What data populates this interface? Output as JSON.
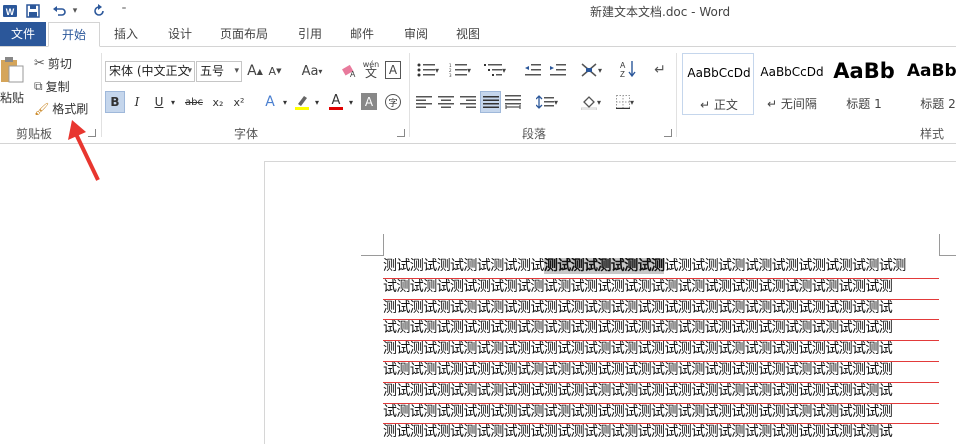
{
  "title_bar": {
    "document_title": "新建文本文档.doc - Word",
    "qat": {
      "save_icon": "save-icon",
      "undo_icon": "undo-icon",
      "redo_icon": "redo-icon",
      "customize_icon": "customize-qat-icon",
      "word_icon": "word-logo-icon"
    }
  },
  "tabs": [
    {
      "label": "文件"
    },
    {
      "label": "开始"
    },
    {
      "label": "插入"
    },
    {
      "label": "设计"
    },
    {
      "label": "页面布局"
    },
    {
      "label": "引用"
    },
    {
      "label": "邮件"
    },
    {
      "label": "审阅"
    },
    {
      "label": "视图"
    }
  ],
  "clipboard": {
    "paste_label": "粘贴",
    "cut_label": "剪切",
    "copy_label": "复制",
    "format_painter_label": "格式刷",
    "group_label": "剪贴板"
  },
  "font": {
    "font_name": "宋体 (中文正文",
    "font_size": "五号",
    "bold": "B",
    "italic": "I",
    "underline": "U",
    "strikethrough": "abc",
    "subscript": "x₂",
    "superscript": "x²",
    "grow": "A",
    "shrink": "A",
    "change_case": "Aa",
    "phonetic": "wén",
    "border_char": "A",
    "font_color": "A",
    "char_shading": "A",
    "enclose": "字",
    "group_label": "字体"
  },
  "paragraph": {
    "group_label": "段落"
  },
  "styles": {
    "group_label": "样式",
    "items": [
      {
        "sample": "AaBbCcDd",
        "name": "正文"
      },
      {
        "sample": "AaBbCcDd",
        "name": "无间隔"
      },
      {
        "sample": "AaBb",
        "name": "标题 1"
      },
      {
        "sample": "AaBbC",
        "name": "标题 2"
      }
    ]
  },
  "document": {
    "lines": [
      {
        "pre": "测试测试测试测试测试测试",
        "sel": "测试测试测试测试测",
        "post": "试测试测试测试测试测试测试测试测试测"
      },
      {
        "pre": "试测试测试测试测试测试测试测试测试测试测试测试测试测试测试测试测试测试测试测",
        "sel": "",
        "post": ""
      },
      {
        "pre": "测试测试测试测试测试测试测试测试测试测试测试测试测试测试测试测试测试测试测试",
        "sel": "",
        "post": ""
      },
      {
        "pre": "试测试测试测试测试测试测试测试测试测试测试测试测试测试测试测试测试测试测试测",
        "sel": "",
        "post": ""
      },
      {
        "pre": "测试测试测试测试测试测试测试测试测试测试测试测试测试测试测试测试测试测试测试",
        "sel": "",
        "post": ""
      },
      {
        "pre": "试测试测试测试测试测试测试测试测试测试测试测试测试测试测试测试测试测试测试测",
        "sel": "",
        "post": ""
      },
      {
        "pre": "测试测试测试测试测试测试测试测试测试测试测试测试测试测试测试测试测试测试测试",
        "sel": "",
        "post": ""
      },
      {
        "pre": "试测试测试测试测试测试测试测试测试测试测试测试测试测试测试测试测试测试测试测",
        "sel": "",
        "post": ""
      },
      {
        "pre": "测试测试测试测试测试测试测试测试测试测试测试测试测试测试测试测试测试测试测试",
        "sel": "",
        "post": ""
      }
    ]
  },
  "colors": {
    "accent": "#2b579a",
    "annotation_arrow": "#e8362f",
    "spellcheck_underline": "#e23a3a",
    "highlight": "#ffff00",
    "font_color": "#e00000"
  }
}
